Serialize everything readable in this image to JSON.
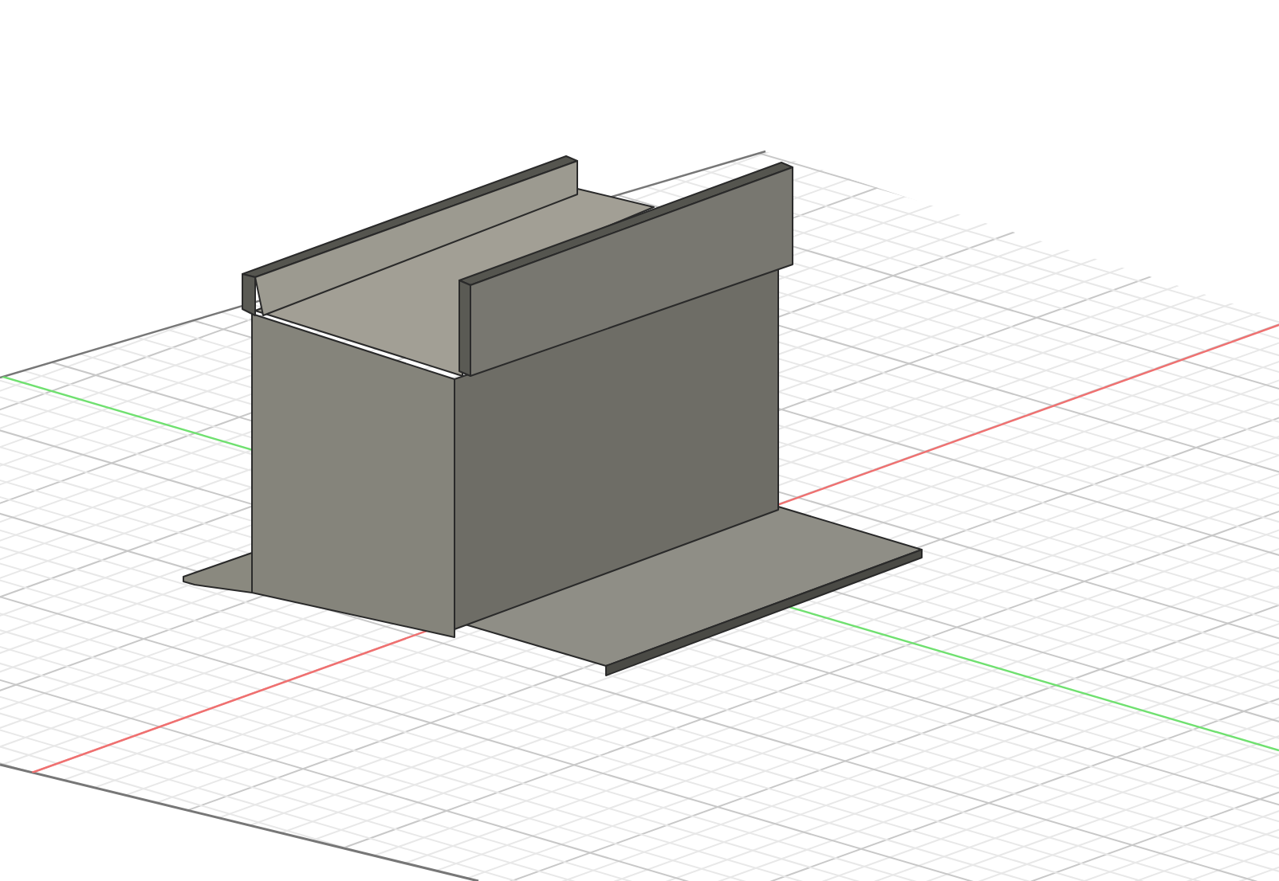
{
  "viewport": {
    "axes": [
      {
        "kind": "x",
        "color": "#f07070"
      },
      {
        "kind": "y",
        "color": "#70e070"
      }
    ]
  }
}
